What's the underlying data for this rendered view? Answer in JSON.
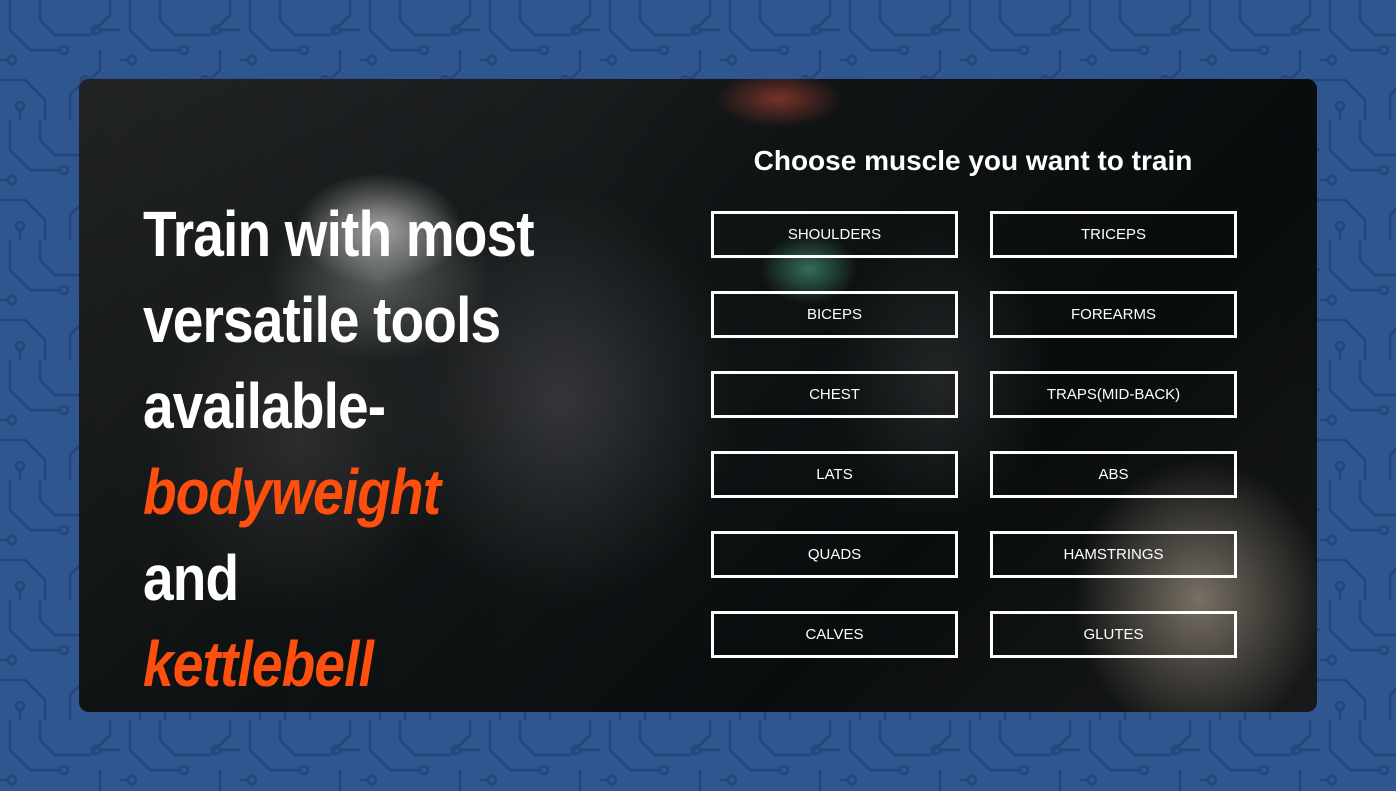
{
  "headline": {
    "line1": "Train with most",
    "line2": "versatile tools",
    "line3": "available-",
    "accent1": "bodyweight",
    "connector": " and",
    "accent2": "kettlebell"
  },
  "picker": {
    "title": "Choose muscle you want to train",
    "options": [
      "SHOULDERS",
      "TRICEPS",
      "BICEPS",
      "FOREARMS",
      "CHEST",
      "TRAPS(MID-BACK)",
      "LATS",
      "ABS",
      "QUADS",
      "HAMSTRINGS",
      "CALVES",
      "GLUTES"
    ]
  },
  "colors": {
    "background": "#2f568f",
    "circuit_lines": "#1f3d6b",
    "accent": "#ff4f0f",
    "text": "#ffffff"
  }
}
